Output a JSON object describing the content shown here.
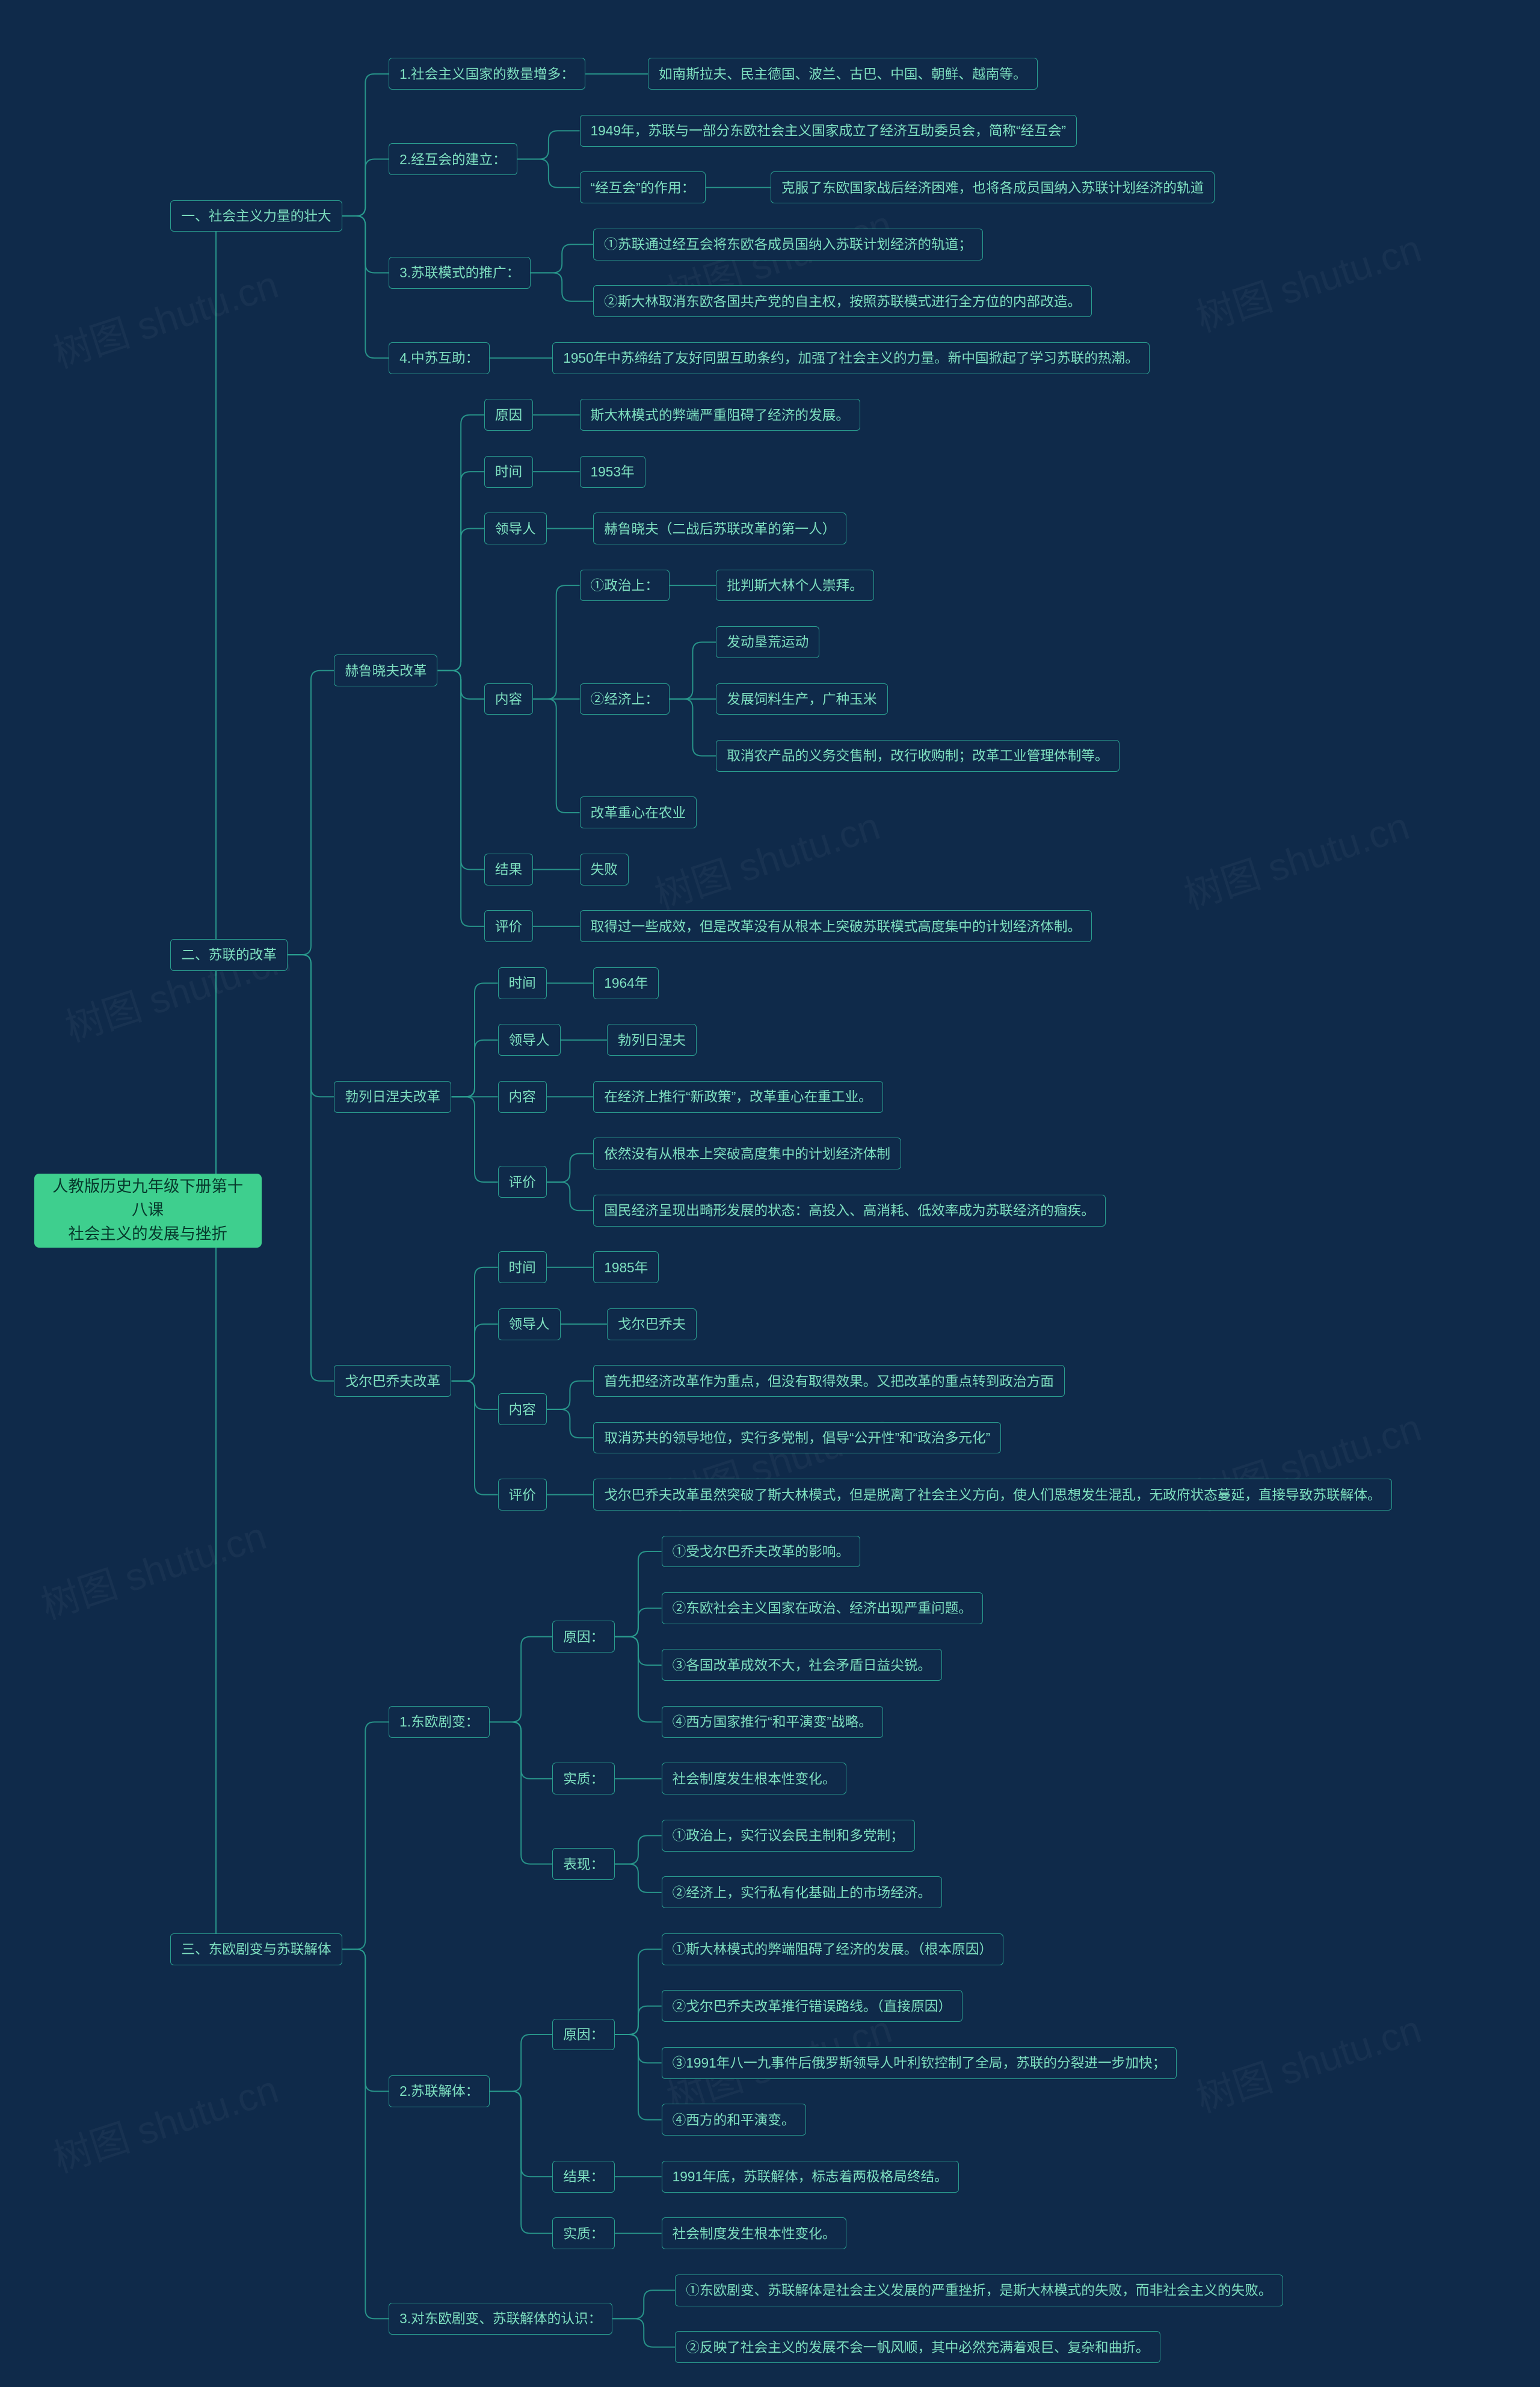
{
  "watermark": "树图 shutu.cn",
  "root": {
    "label": "人教版历史九年级下册第十八课\n社会主义的发展与挫折"
  },
  "sections": [
    {
      "label": "一、社会主义力量的壮大",
      "children": [
        {
          "label": "1.社会主义国家的数量增多：",
          "children": [
            {
              "label": "如南斯拉夫、民主德国、波兰、古巴、中国、朝鲜、越南等。"
            }
          ]
        },
        {
          "label": "2.经互会的建立：",
          "children": [
            {
              "label": "1949年，苏联与一部分东欧社会主义国家成立了经济互助委员会，简称“经互会”"
            },
            {
              "label": "“经互会”的作用：",
              "children": [
                {
                  "label": "克服了东欧国家战后经济困难，也将各成员国纳入苏联计划经济的轨道"
                }
              ]
            }
          ]
        },
        {
          "label": "3.苏联模式的推广：",
          "children": [
            {
              "label": "①苏联通过经互会将东欧各成员国纳入苏联计划经济的轨道；"
            },
            {
              "label": "②斯大林取消东欧各国共产党的自主权，按照苏联模式进行全方位的内部改造。"
            }
          ]
        },
        {
          "label": "4.中苏互助：",
          "children": [
            {
              "label": "1950年中苏缔结了友好同盟互助条约，加强了社会主义的力量。新中国掀起了学习苏联的热潮。"
            }
          ]
        }
      ]
    },
    {
      "label": "二、苏联的改革",
      "children": [
        {
          "label": "赫鲁晓夫改革",
          "children": [
            {
              "label": "原因",
              "children": [
                {
                  "label": "斯大林模式的弊端严重阻碍了经济的发展。"
                }
              ]
            },
            {
              "label": "时间",
              "children": [
                {
                  "label": "1953年"
                }
              ]
            },
            {
              "label": "领导人",
              "children": [
                {
                  "label": "赫鲁晓夫（二战后苏联改革的第一人）"
                }
              ]
            },
            {
              "label": "内容",
              "children": [
                {
                  "label": "①政治上：",
                  "children": [
                    {
                      "label": "批判斯大林个人崇拜。"
                    }
                  ]
                },
                {
                  "label": "②经济上：",
                  "children": [
                    {
                      "label": "发动垦荒运动"
                    },
                    {
                      "label": "发展饲料生产，广种玉米"
                    },
                    {
                      "label": "取消农产品的义务交售制，改行收购制；改革工业管理体制等。"
                    }
                  ]
                },
                {
                  "label": "改革重心在农业"
                }
              ]
            },
            {
              "label": "结果",
              "children": [
                {
                  "label": "失败"
                }
              ]
            },
            {
              "label": "评价",
              "children": [
                {
                  "label": "取得过一些成效，但是改革没有从根本上突破苏联模式高度集中的计划经济体制。"
                }
              ]
            }
          ]
        },
        {
          "label": "勃列日涅夫改革",
          "children": [
            {
              "label": "时间",
              "children": [
                {
                  "label": "1964年"
                }
              ]
            },
            {
              "label": "领导人",
              "children": [
                {
                  "label": "勃列日涅夫"
                }
              ]
            },
            {
              "label": "内容",
              "children": [
                {
                  "label": "在经济上推行“新政策”，改革重心在重工业。"
                }
              ]
            },
            {
              "label": "评价",
              "children": [
                {
                  "label": "依然没有从根本上突破高度集中的计划经济体制"
                },
                {
                  "label": "国民经济呈现出畸形发展的状态：高投入、高消耗、低效率成为苏联经济的痼疾。"
                }
              ]
            }
          ]
        },
        {
          "label": "戈尔巴乔夫改革",
          "children": [
            {
              "label": "时间",
              "children": [
                {
                  "label": "1985年"
                }
              ]
            },
            {
              "label": "领导人",
              "children": [
                {
                  "label": "戈尔巴乔夫"
                }
              ]
            },
            {
              "label": "内容",
              "children": [
                {
                  "label": "首先把经济改革作为重点，但没有取得效果。又把改革的重点转到政治方面"
                },
                {
                  "label": "取消苏共的领导地位，实行多党制，倡导“公开性”和“政治多元化”"
                }
              ]
            },
            {
              "label": "评价",
              "children": [
                {
                  "label": "戈尔巴乔夫改革虽然突破了斯大林模式，但是脱离了社会主义方向，使人们思想发生混乱，无政府状态蔓延，直接导致苏联解体。"
                }
              ]
            }
          ]
        }
      ]
    },
    {
      "label": "三、东欧剧变与苏联解体",
      "children": [
        {
          "label": "1.东欧剧变：",
          "children": [
            {
              "label": "原因：",
              "children": [
                {
                  "label": "①受戈尔巴乔夫改革的影响。"
                },
                {
                  "label": "②东欧社会主义国家在政治、经济出现严重问题。"
                },
                {
                  "label": "③各国改革成效不大，社会矛盾日益尖锐。"
                },
                {
                  "label": "④西方国家推行“和平演变”战略。"
                }
              ]
            },
            {
              "label": "实质：",
              "children": [
                {
                  "label": "社会制度发生根本性变化。"
                }
              ]
            },
            {
              "label": "表现：",
              "children": [
                {
                  "label": "①政治上，实行议会民主制和多党制；"
                },
                {
                  "label": "②经济上，实行私有化基础上的市场经济。"
                }
              ]
            }
          ]
        },
        {
          "label": "2.苏联解体：",
          "children": [
            {
              "label": "原因：",
              "children": [
                {
                  "label": "①斯大林模式的弊端阻碍了经济的发展。（根本原因）"
                },
                {
                  "label": "②戈尔巴乔夫改革推行错误路线。（直接原因）"
                },
                {
                  "label": "③1991年八一九事件后俄罗斯领导人叶利钦控制了全局，苏联的分裂进一步加快；"
                },
                {
                  "label": "④西方的和平演变。"
                }
              ]
            },
            {
              "label": "结果：",
              "children": [
                {
                  "label": "1991年底，苏联解体，标志着两极格局终结。"
                }
              ]
            },
            {
              "label": "实质：",
              "children": [
                {
                  "label": "社会制度发生根本性变化。"
                }
              ]
            }
          ]
        },
        {
          "label": "3.对东欧剧变、苏联解体的认识：",
          "children": [
            {
              "label": "①东欧剧变、苏联解体是社会主义发展的严重挫折，是斯大林模式的失败，而非社会主义的失败。"
            },
            {
              "label": "②反映了社会主义的发展不会一帆风顺，其中必然充满着艰巨、复杂和曲折。"
            }
          ]
        }
      ]
    }
  ]
}
